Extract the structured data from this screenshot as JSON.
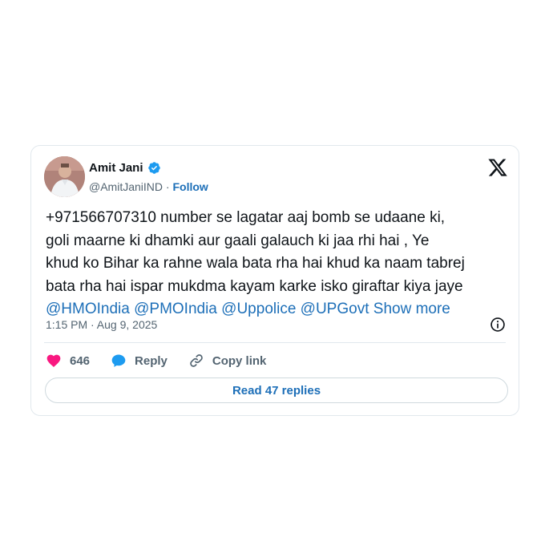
{
  "author": {
    "name": "Amit Jani",
    "handle": "@AmitJaniIND",
    "separator": " · ",
    "follow_label": "Follow",
    "verified_icon": "verified-badge-icon",
    "verified_color": "#1d9bf0"
  },
  "post": {
    "text_line_1": "+971566707310 number se lagatar aaj bomb se udaane ki,",
    "text_line_2": "goli maarne ki dhamki aur gaali galauch ki jaa rhi hai , Ye",
    "text_line_3": "khud ko Bihar ka rahne wala bata rha hai khud ka naam tabrej",
    "text_line_4": "bata rha hai ispar mukdma kayam karke isko giraftar kiya jaye",
    "mentions": [
      "@HMOIndia",
      "@PMOIndia",
      "@Uppolice",
      "@UPGovt"
    ],
    "show_more": "Show more",
    "timestamp": "1:15 PM · Aug 9, 2025"
  },
  "actions": {
    "like_count": "646",
    "reply_label": "Reply",
    "copy_link_label": "Copy link",
    "read_replies_label": "Read 47 replies"
  },
  "colors": {
    "accent": "#1d6fb8",
    "like": "#f91880",
    "reply_icon": "#1d9bf0",
    "muted": "#536471"
  }
}
